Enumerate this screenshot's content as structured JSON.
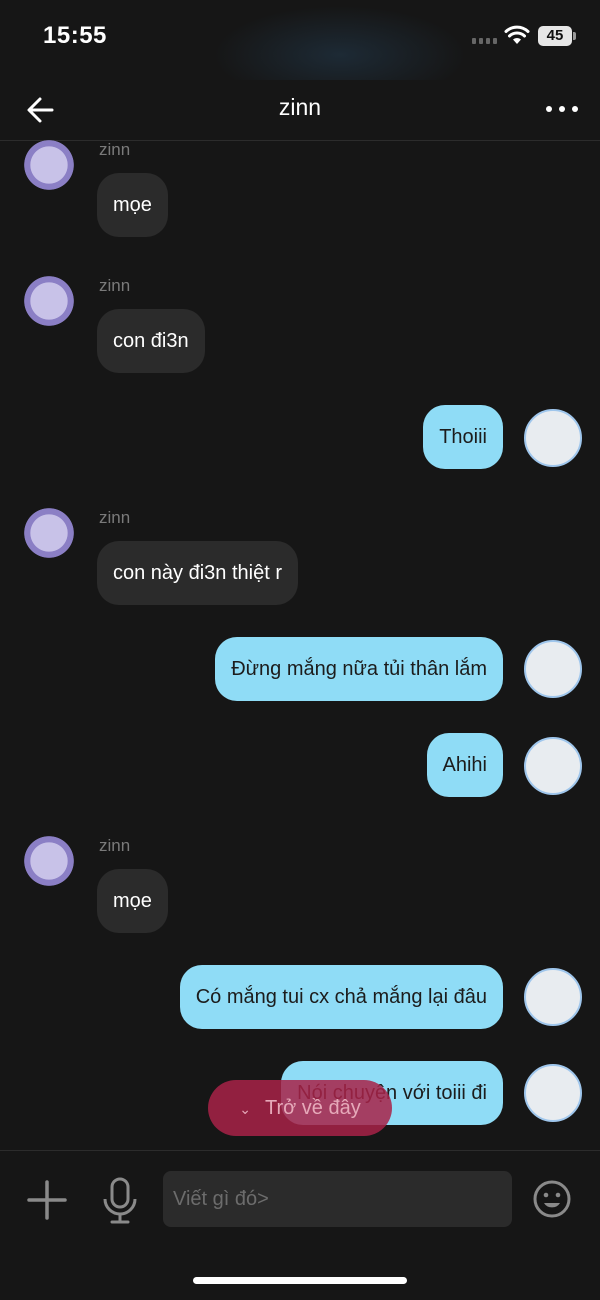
{
  "status": {
    "time": "15:55",
    "battery": "45"
  },
  "nav": {
    "title": "zinn"
  },
  "messages": [
    {
      "sender": "zinn",
      "text": "mọe"
    },
    {
      "sender": "zinn",
      "text": "con đi3n"
    },
    {
      "text": "Thoiii"
    },
    {
      "sender": "zinn",
      "text": "con này đi3n thiệt r"
    },
    {
      "text": "Đừng mắng nữa tủi thân lắm"
    },
    {
      "text": "Ahihi"
    },
    {
      "sender": "zinn",
      "text": "mọe"
    },
    {
      "text": "Có mắng tui cx chả mắng lại đâu"
    },
    {
      "text": "Nói chuyện với toiii đi"
    }
  ],
  "scroll_button": {
    "label": "Trở về đây"
  },
  "composer": {
    "placeholder": "Viết gì đó>"
  },
  "colors": {
    "outgoing_bubble": "#8fdcf6",
    "incoming_bubble": "#2b2b2b",
    "background": "#161616",
    "scroll_button": "#a82248"
  },
  "icons": [
    "back-arrow-icon",
    "more-dots-icon",
    "plus-icon",
    "microphone-icon",
    "emoji-icon",
    "wifi-icon",
    "signal-icon"
  ]
}
